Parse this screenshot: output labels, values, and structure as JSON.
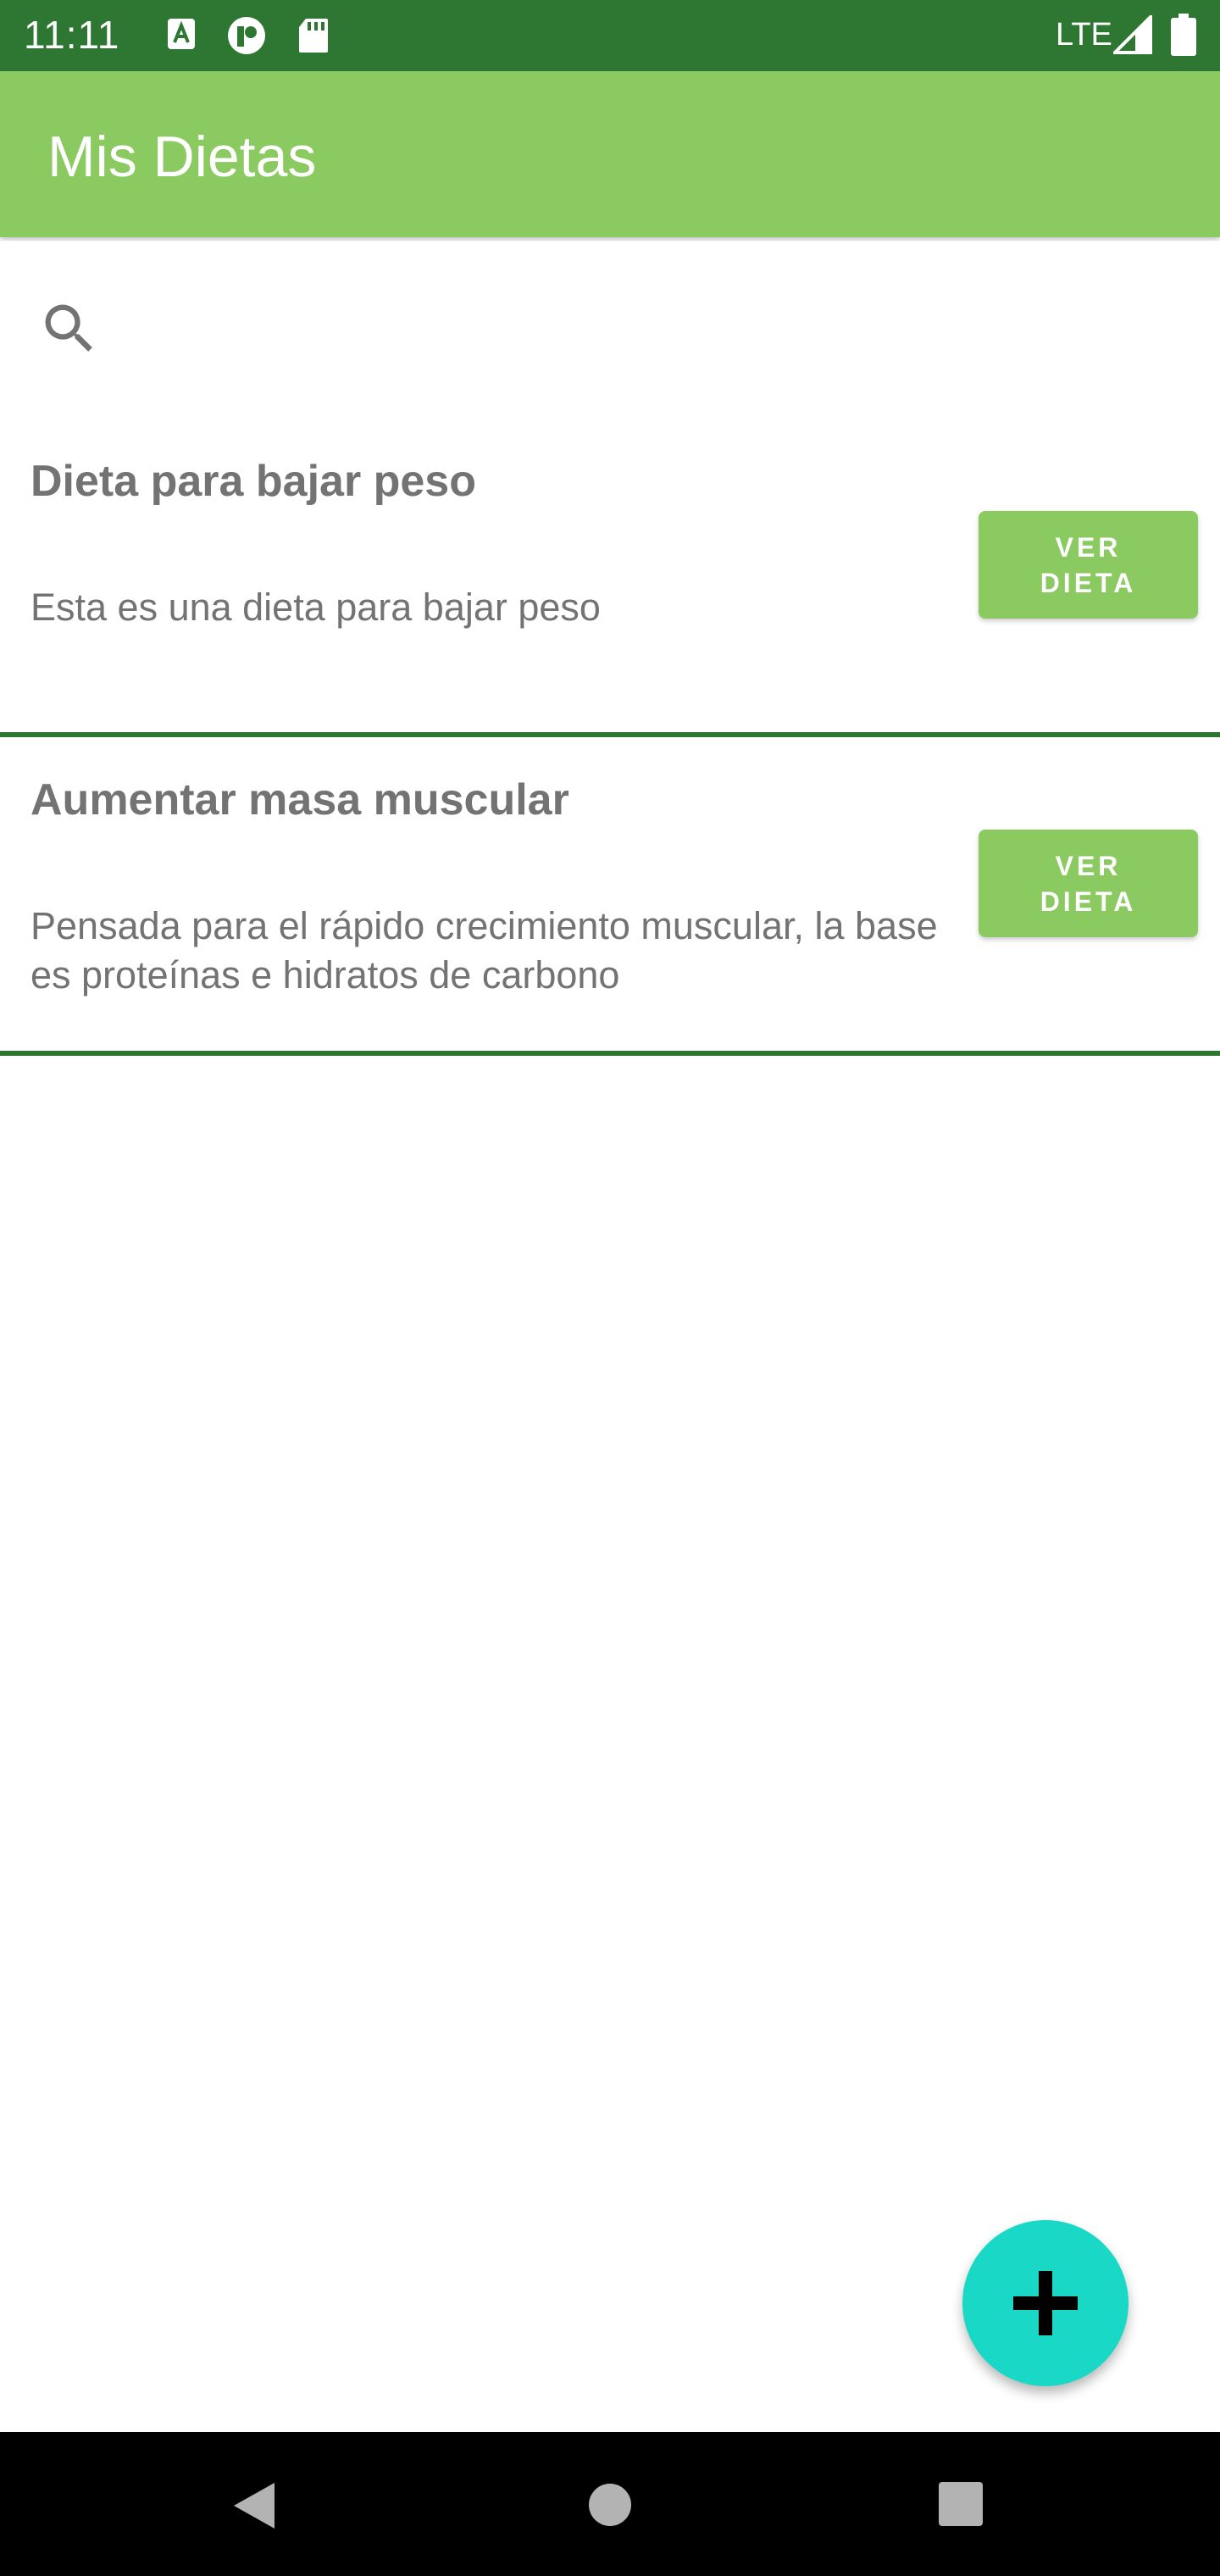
{
  "status_bar": {
    "time": "11:11",
    "network": "LTE",
    "icons": [
      "a-notification-icon",
      "p-notification-icon",
      "sd-card-icon",
      "signal-icon",
      "battery-icon"
    ],
    "background": "#2e7733"
  },
  "app_bar": {
    "title": "Mis Dietas",
    "color": "#8bc961"
  },
  "search": {
    "icon": "search-icon",
    "placeholder": ""
  },
  "diets": [
    {
      "title": "Dieta para bajar peso",
      "description": "Esta es una dieta para bajar peso",
      "button_label": "VER DIETA"
    },
    {
      "title": "Aumentar masa muscular",
      "description": "Pensada para el rápido crecimiento muscular, la base es proteínas e hidratos de carbono",
      "button_label": "VER DIETA"
    }
  ],
  "fab": {
    "icon": "plus-icon",
    "color": "#19d9c6"
  },
  "nav_bar": {
    "icons": [
      "back-icon",
      "home-icon",
      "recents-icon"
    ]
  }
}
